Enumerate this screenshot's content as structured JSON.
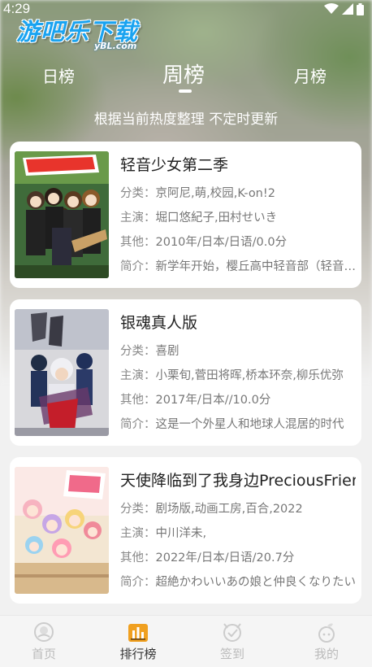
{
  "status_bar": {
    "time": "4:29"
  },
  "logo": {
    "main_text": "游吧乐下载",
    "sub_text": "yBL.com"
  },
  "tabs": [
    {
      "label": "日榜",
      "active": false
    },
    {
      "label": "周榜",
      "active": true
    },
    {
      "label": "月榜",
      "active": false
    }
  ],
  "subtitle": "根据当前热度整理 不定时更新",
  "cards": [
    {
      "title": "轻音少女第二季",
      "category_label": "分类：",
      "category": "京阿尼,萌,校园,K-on!2",
      "cast_label": "主演：",
      "cast": "堀口悠紀子,田村せいき",
      "other_label": "其他：",
      "other": "2010年/日本/日语/0.0分",
      "intro_label": "简介：",
      "intro": "新学年开始，樱丘高中轻音部（轻音部）的五名成员"
    },
    {
      "title": "银魂真人版",
      "category_label": "分类：",
      "category": "喜剧",
      "cast_label": "主演：",
      "cast": "小栗旬,菅田将晖,桥本环奈,柳乐优弥",
      "other_label": "其他：",
      "other": "2017年/日本//10.0分",
      "intro_label": "简介：",
      "intro": "这是一个外星人和地球人混居的时代"
    },
    {
      "title": "天使降临到了我身边PreciousFriends",
      "category_label": "分类：",
      "category": "剧场版,动画工房,百合,2022",
      "cast_label": "主演：",
      "cast": "中川洋未,",
      "other_label": "其他：",
      "other": "2022年/日本/日语/20.7分",
      "intro_label": "简介：",
      "intro": "超絶かわいいあの娘と仲良くなりたい"
    }
  ],
  "bottom_nav": [
    {
      "label": "首页",
      "icon": "home-icon",
      "active": false
    },
    {
      "label": "排行榜",
      "icon": "ranking-icon",
      "active": true
    },
    {
      "label": "签到",
      "icon": "checkin-icon",
      "active": false
    },
    {
      "label": "我的",
      "icon": "profile-icon",
      "active": false
    }
  ],
  "colors": {
    "accent": "#f0a020",
    "logo_blue": "#1aa3f0"
  }
}
